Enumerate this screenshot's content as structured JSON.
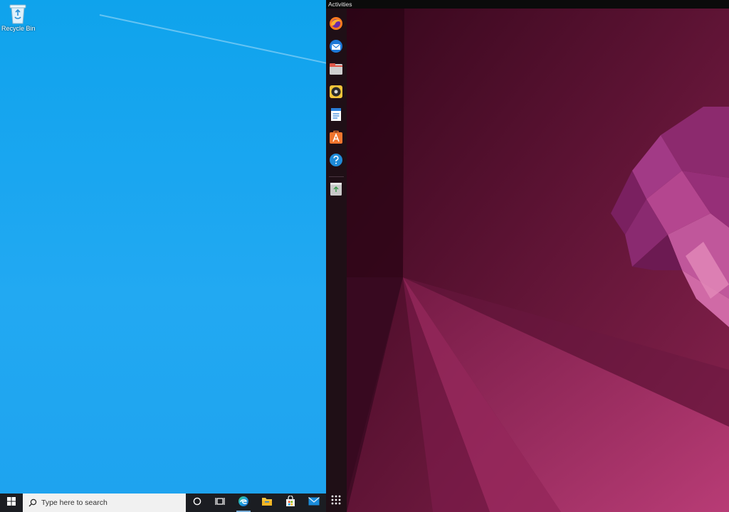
{
  "windows": {
    "desktop": {
      "recycle_bin_label": "Recycle Bin"
    },
    "taskbar": {
      "start_icon": "windows-start-icon",
      "search_placeholder": "Type here to search",
      "pinned": [
        "cortana-icon",
        "task-view-icon",
        "edge-icon",
        "file-explorer-icon",
        "store-icon",
        "mail-icon"
      ]
    },
    "colors": {
      "desktop_bg": "#1aa6f0",
      "taskbar_bg": "#1b1d22"
    }
  },
  "ubuntu": {
    "top_bar": {
      "activities_label": "Activities"
    },
    "dock": {
      "apps": [
        "firefox-icon",
        "thunderbird-icon",
        "files-icon",
        "rhythmbox-icon",
        "writer-icon",
        "software-icon",
        "help-icon"
      ],
      "trash": "trash-icon",
      "show_apps": "show-applications-icon"
    },
    "colors": {
      "wallpaper_dark": "#3a0a1e",
      "wallpaper_light": "#b03570",
      "dock_bg": "#1f0f16"
    }
  }
}
